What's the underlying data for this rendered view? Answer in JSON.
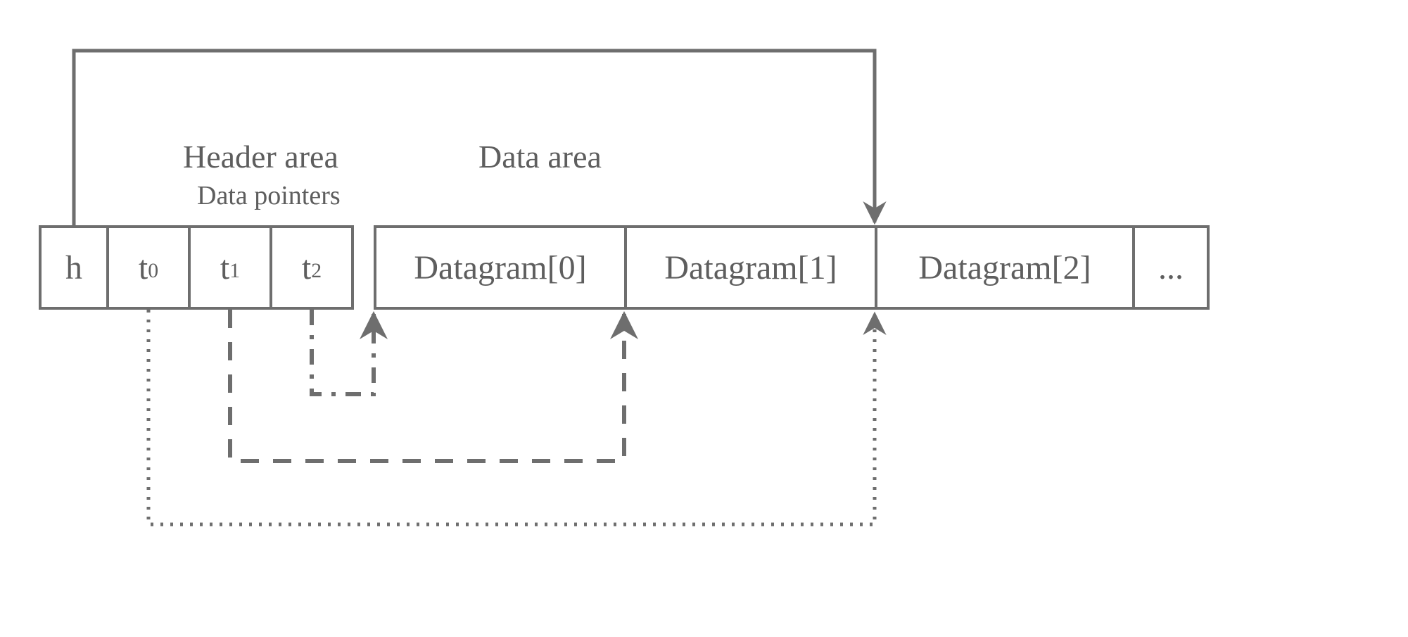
{
  "labels": {
    "header_area": "Header area",
    "data_pointers": "Data pointers",
    "data_area": "Data area"
  },
  "header": {
    "h": "h",
    "t0_base": "t",
    "t0_sub": "0",
    "t1_base": "t",
    "t1_sub": "1",
    "t2_base": "t",
    "t2_sub": "2"
  },
  "data": {
    "d0": "Datagram[0]",
    "d1": "Datagram[1]",
    "d2": "Datagram[2]",
    "ellipsis": "..."
  },
  "diagram": {
    "description": "Memory layout with a header area containing a head pointer h and tail pointers t0, t1, t2, followed by a data area containing Datagram[0], Datagram[1], Datagram[2], ... . h points to the end of Datagram[1]. t2 points to the start of Datagram[0]. t1 points to the start of Datagram[1]. t0 points to the start of Datagram[2].",
    "pointers": [
      {
        "from": "h",
        "to": "end-of-Datagram[1]",
        "style": "solid"
      },
      {
        "from": "t2",
        "to": "start-of-Datagram[0]",
        "style": "dash-dot"
      },
      {
        "from": "t1",
        "to": "start-of-Datagram[1]",
        "style": "dashed"
      },
      {
        "from": "t0",
        "to": "start-of-Datagram[2]",
        "style": "dotted"
      }
    ]
  }
}
